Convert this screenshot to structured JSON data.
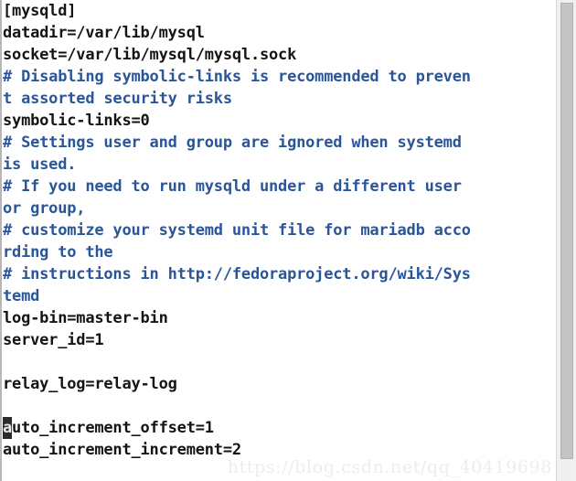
{
  "editor": {
    "file_kind": "mysql-config",
    "colors": {
      "background": "#ffffff",
      "plain_text": "#141414",
      "comment_text": "#2a5699",
      "cursor_background": "#2b2b2b",
      "cursor_foreground": "#e8e8e8",
      "scrollbar_thumb": "#c4c4c4",
      "scrollbar_track": "#efefef",
      "watermark": "#ededed"
    },
    "lines": [
      {
        "text": "[mysqld]",
        "kind": "plain"
      },
      {
        "text": "datadir=/var/lib/mysql",
        "kind": "plain"
      },
      {
        "text": "socket=/var/lib/mysql/mysql.sock",
        "kind": "plain"
      },
      {
        "text": "# Disabling symbolic-links is recommended to preven",
        "kind": "comment"
      },
      {
        "text": "t assorted security risks",
        "kind": "comment"
      },
      {
        "text": "symbolic-links=0",
        "kind": "plain"
      },
      {
        "text": "# Settings user and group are ignored when systemd",
        "kind": "comment"
      },
      {
        "text": "is used.",
        "kind": "comment"
      },
      {
        "text": "# If you need to run mysqld under a different user",
        "kind": "comment"
      },
      {
        "text": "or group,",
        "kind": "comment"
      },
      {
        "text": "# customize your systemd unit file for mariadb acco",
        "kind": "comment"
      },
      {
        "text": "rding to the",
        "kind": "comment"
      },
      {
        "text": "# instructions in http://fedoraproject.org/wiki/Sys",
        "kind": "comment"
      },
      {
        "text": "temd",
        "kind": "comment"
      },
      {
        "text": "log-bin=master-bin",
        "kind": "plain"
      },
      {
        "text": "server_id=1",
        "kind": "plain"
      },
      {
        "text": "",
        "kind": "blank"
      },
      {
        "text": "relay_log=relay-log",
        "kind": "plain"
      },
      {
        "text": "",
        "kind": "blank"
      },
      {
        "text": "auto_increment_offset=1",
        "kind": "plain",
        "cursor_at": 0
      },
      {
        "text": "auto_increment_increment=2",
        "kind": "plain"
      }
    ]
  },
  "scrollbar": {
    "orientation": "vertical",
    "thumb_position_percent": 0,
    "thumb_size_percent": 96
  },
  "watermark": {
    "text": "https://blog.csdn.net/qq_40419698"
  }
}
